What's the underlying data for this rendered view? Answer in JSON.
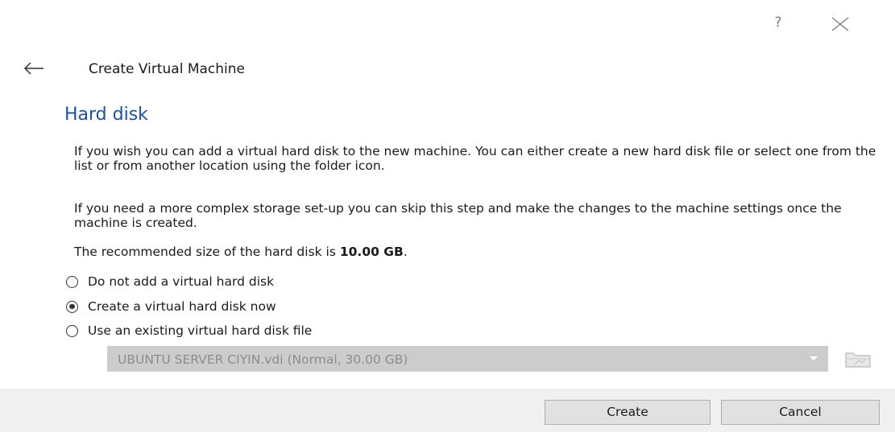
{
  "window": {
    "help_glyph": "?",
    "close_icon": "close-icon"
  },
  "wizard": {
    "back_icon": "back-arrow-icon",
    "title": "Create Virtual Machine"
  },
  "page": {
    "heading": "Hard disk",
    "paragraph_1": "If you wish you can add a virtual hard disk to the new machine. You can either create a new hard disk file or select one from the list or from another location using the folder icon.",
    "paragraph_2": "If you need a more complex storage set-up you can skip this step and make the changes to the machine settings once the machine is created.",
    "recommendation_prefix": "The recommended size of the hard disk is ",
    "recommendation_size": "10.00 GB",
    "recommendation_suffix": "."
  },
  "options": [
    {
      "label": "Do not add a virtual hard disk",
      "selected": false
    },
    {
      "label": "Create a virtual hard disk now",
      "selected": true
    },
    {
      "label": "Use an existing virtual hard disk file",
      "selected": false
    }
  ],
  "existing_disk": {
    "selected_value": "UBUNTU SERVER CIYIN.vdi (Normal, 30.00 GB)",
    "enabled": false,
    "folder_icon": "folder-icon"
  },
  "buttons": {
    "create_label": "Create",
    "cancel_label": "Cancel"
  },
  "colors": {
    "heading": "#1a4fb5",
    "footer_bg": "#f0f0f0",
    "disabled_field": "#cccccc"
  }
}
